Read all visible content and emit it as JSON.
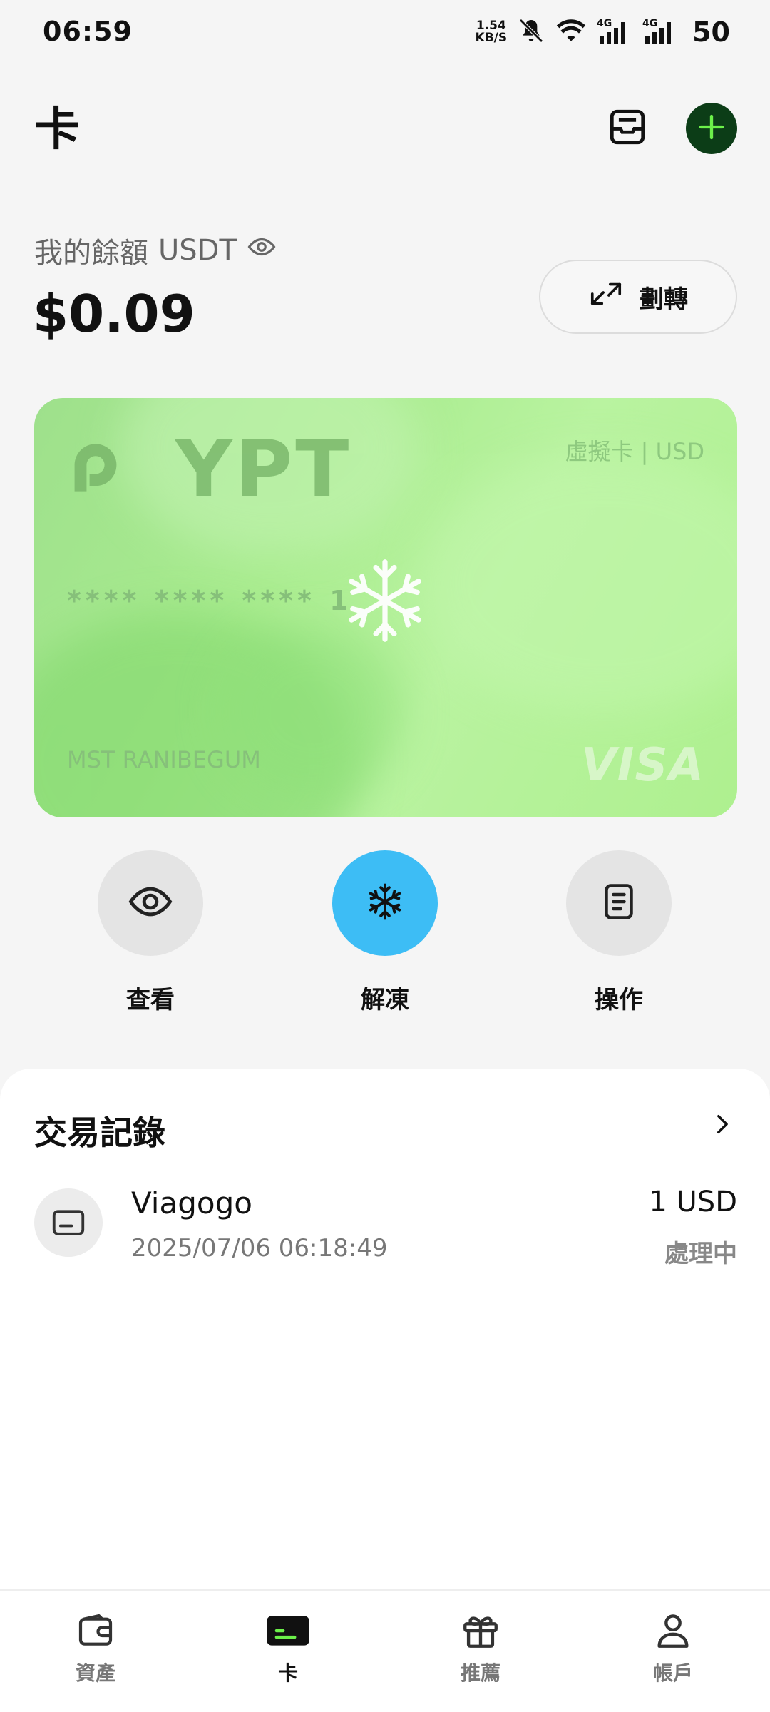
{
  "status_bar": {
    "time": "06:59",
    "net_speed_value": "1.54",
    "net_speed_unit": "KB/S",
    "battery": "50"
  },
  "header": {
    "title": "卡",
    "inbox_icon": "inbox-icon",
    "add_icon": "plus-icon"
  },
  "balance": {
    "label": "我的餘額",
    "currency": "USDT",
    "amount": "$0.09",
    "transfer_label": "劃轉"
  },
  "card": {
    "brand": "YPT",
    "type": "虛擬卡 | USD",
    "number": "**** **** **** 1",
    "holder": "MST RANIBEGUM",
    "network": "VISA",
    "frozen": true,
    "colors": {
      "accent": "#a9ec8f"
    }
  },
  "actions": [
    {
      "label": "查看",
      "icon": "eye-icon"
    },
    {
      "label": "解凍",
      "icon": "snowflake-icon"
    },
    {
      "label": "操作",
      "icon": "document-icon"
    }
  ],
  "transactions": {
    "title": "交易記錄",
    "items": [
      {
        "merchant": "Viagogo",
        "date": "2025/07/06 06:18:49",
        "amount": "1 USD",
        "status": "處理中",
        "icon": "card-icon"
      }
    ]
  },
  "nav": {
    "items": [
      {
        "label": "資產",
        "icon": "wallet-icon"
      },
      {
        "label": "卡",
        "icon": "card-icon",
        "active": true
      },
      {
        "label": "推薦",
        "icon": "gift-icon"
      },
      {
        "label": "帳戶",
        "icon": "user-icon"
      }
    ]
  },
  "colors": {
    "unfreeze_button": "#3dbdf5",
    "add_button": "#0c3d17",
    "add_icon": "#6cf04a"
  }
}
